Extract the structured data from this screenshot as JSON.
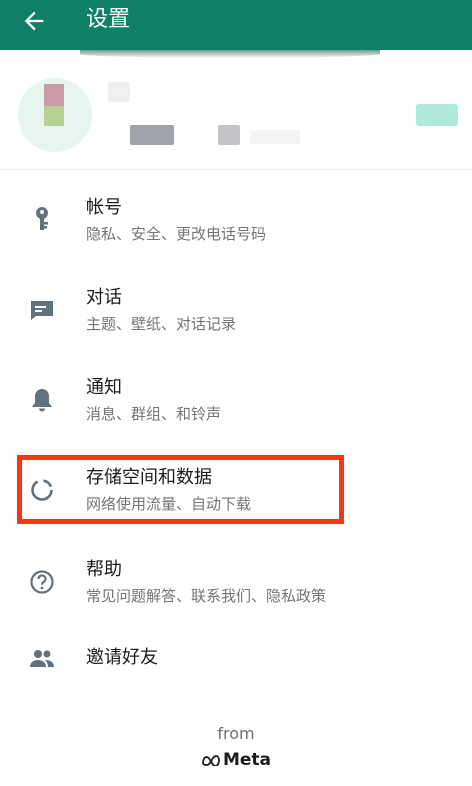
{
  "header": {
    "title": "设置"
  },
  "settings": [
    {
      "title": "帐号",
      "subtitle": "隐私、安全、更改电话号码",
      "icon": "key-icon"
    },
    {
      "title": "对话",
      "subtitle": "主题、壁纸、对话记录",
      "icon": "chat-icon"
    },
    {
      "title": "通知",
      "subtitle": "消息、群组、和铃声",
      "icon": "bell-icon"
    },
    {
      "title": "存储空间和数据",
      "subtitle": "网络使用流量、自动下载",
      "icon": "storage-circle-icon",
      "highlighted": true
    },
    {
      "title": "帮助",
      "subtitle": "常见问题解答、联系我们、隐私政策",
      "icon": "help-icon"
    },
    {
      "title": "邀请好友",
      "icon": "people-icon"
    }
  ],
  "footer": {
    "from": "from",
    "brand": "Meta"
  },
  "colors": {
    "appbar": "#0f8066",
    "icon": "#62727c",
    "highlight": "#f2371b",
    "qr": "#aee9d9"
  }
}
